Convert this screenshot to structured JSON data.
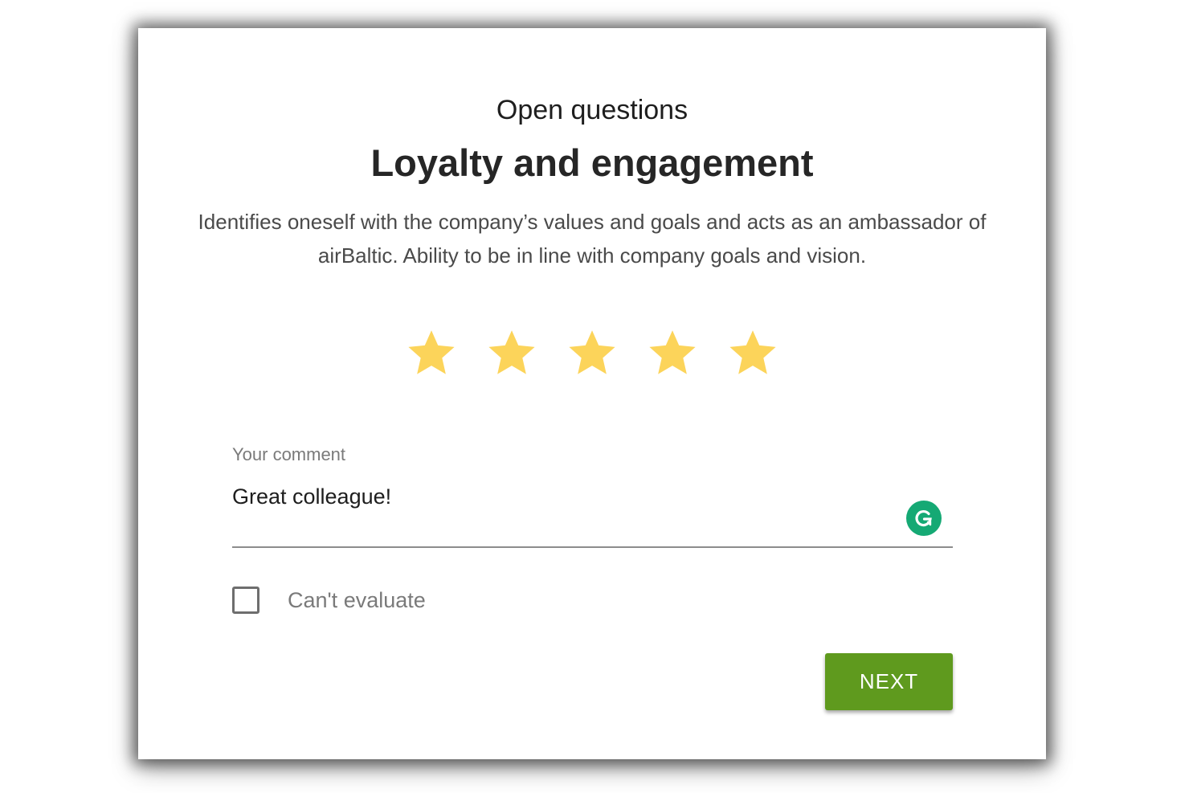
{
  "header": {
    "subtitle": "Open questions",
    "title": "Loyalty and engagement",
    "description": "Identifies oneself with the company’s values and goals and acts as an ambassador of airBaltic. Ability to be in line with company goals and vision."
  },
  "rating": {
    "value": 5,
    "max": 5,
    "star_color": "#FCD45A",
    "icon": "star-icon"
  },
  "comment": {
    "label": "Your comment",
    "value": "Great colleague!",
    "assistant_icon": "grammarly-icon",
    "assistant_color": "#15A974"
  },
  "cant_evaluate": {
    "label": "Can't evaluate",
    "checked": false
  },
  "actions": {
    "next_label": "NEXT",
    "next_color": "#5F9A1E"
  }
}
